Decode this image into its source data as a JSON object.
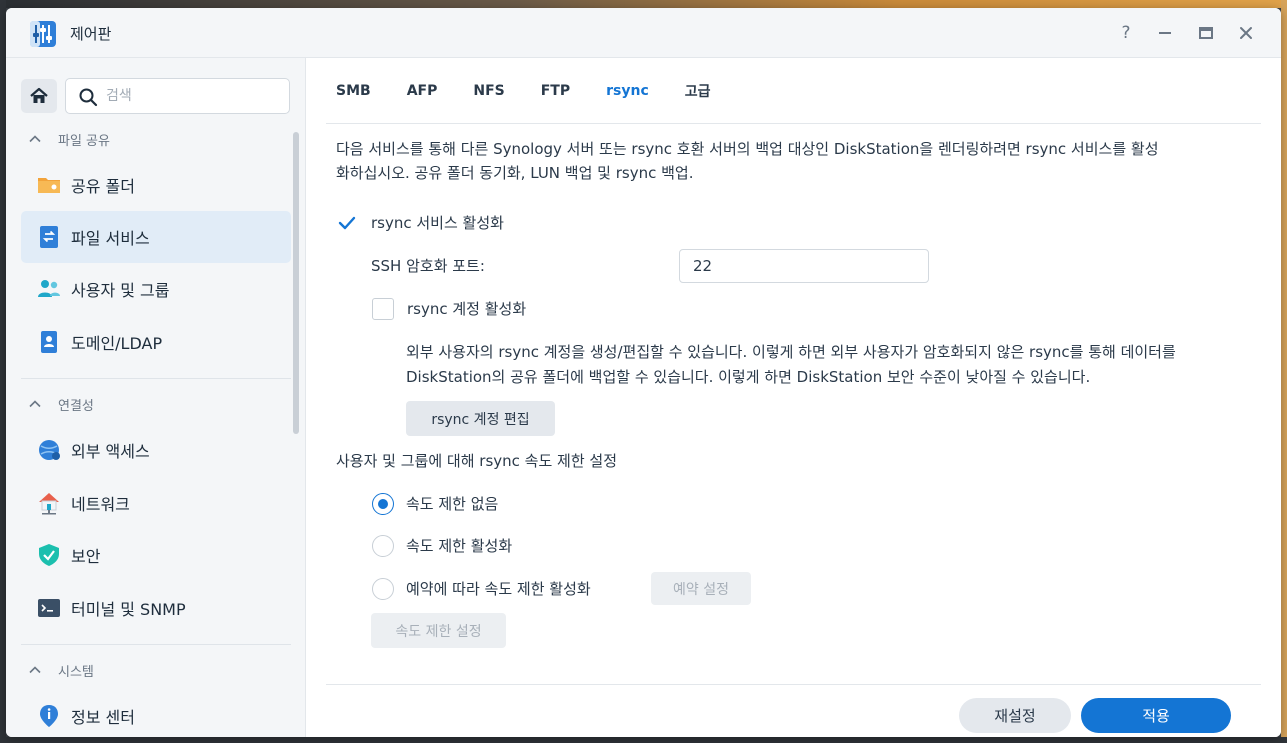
{
  "window": {
    "title": "제어판",
    "help_label": "?"
  },
  "sidebar": {
    "search_placeholder": "검색",
    "sections": [
      {
        "label": "파일 공유"
      },
      {
        "label": "연결성"
      },
      {
        "label": "시스템"
      }
    ],
    "items": [
      {
        "label": "공유 폴더",
        "icon": "shared-folder-icon"
      },
      {
        "label": "파일 서비스",
        "icon": "file-services-icon",
        "active": true
      },
      {
        "label": "사용자 및 그룹",
        "icon": "users-groups-icon"
      },
      {
        "label": "도메인/LDAP",
        "icon": "domain-ldap-icon"
      },
      {
        "label": "외부 액세스",
        "icon": "external-access-icon"
      },
      {
        "label": "네트워크",
        "icon": "network-icon"
      },
      {
        "label": "보안",
        "icon": "security-shield-icon"
      },
      {
        "label": "터미널 및 SNMP",
        "icon": "terminal-icon"
      },
      {
        "label": "정보 센터",
        "icon": "info-center-icon"
      }
    ]
  },
  "tabs": [
    {
      "label": "SMB"
    },
    {
      "label": "AFP"
    },
    {
      "label": "NFS"
    },
    {
      "label": "FTP"
    },
    {
      "label": "rsync",
      "active": true
    },
    {
      "label": "고급"
    }
  ],
  "rsync": {
    "description_line1": "다음 서비스를 통해 다른 Synology 서버 또는 rsync 호환 서버의 백업 대상인 DiskStation을 렌더링하려면 rsync 서비스를 활성",
    "description_line2": "화하십시오. 공유 폴더 동기화, LUN 백업 및 rsync 백업.",
    "enable_service_label": "rsync 서비스 활성화",
    "enable_service_checked": true,
    "ssh_port_label": "SSH 암호화 포트:",
    "ssh_port_value": "22",
    "enable_account_label": "rsync 계정 활성화",
    "enable_account_checked": false,
    "account_desc_line1": "외부 사용자의 rsync 계정을 생성/편집할 수 있습니다. 이렇게 하면 외부 사용자가 암호화되지 않은 rsync를 통해 데이터를",
    "account_desc_line2": "DiskStation의 공유 폴더에 백업할 수 있습니다. 이렇게 하면 DiskStation 보안 수준이 낮아질 수 있습니다.",
    "edit_account_button": "rsync 계정 편집",
    "speed_limit_title": "사용자 및 그룹에 대해 rsync 속도 제한 설정",
    "speed_options": [
      {
        "label": "속도 제한 없음",
        "selected": true
      },
      {
        "label": "속도 제한 활성화",
        "selected": false
      },
      {
        "label": "예약에 따라 속도 제한 활성화",
        "selected": false
      }
    ],
    "schedule_button": "예약 설정",
    "speed_settings_button": "속도 제한 설정"
  },
  "footer": {
    "reset_label": "재설정",
    "apply_label": "적용"
  },
  "colors": {
    "accent": "#1475d4",
    "active_bg": "#e1ecf7"
  }
}
